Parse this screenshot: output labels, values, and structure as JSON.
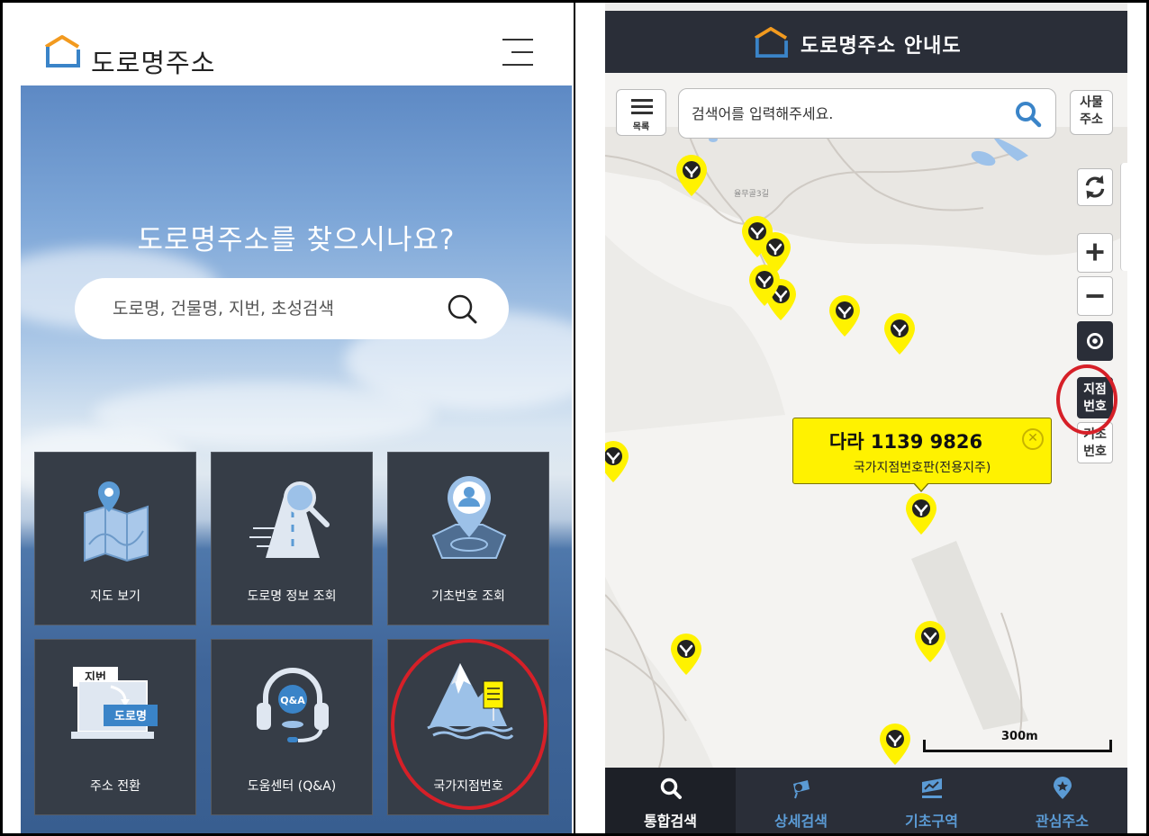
{
  "left_panel": {
    "header": {
      "title": "도로명주소"
    },
    "hero": {
      "heading": "도로명주소를 찾으시나요?",
      "search_placeholder": "도로명, 건물명, 지번, 초성검색"
    },
    "tiles": [
      {
        "label": "지도 보기",
        "icon": "map-pin-icon"
      },
      {
        "label": "도로명 정보 조회",
        "icon": "road-search-icon"
      },
      {
        "label": "기초번호 조회",
        "icon": "location-person-icon"
      },
      {
        "label": "주소 전환",
        "icon": "address-convert-icon",
        "badge_top": "지번",
        "badge_bottom": "도로명"
      },
      {
        "label": "도움센터 (Q&A)",
        "icon": "headset-icon",
        "badge": "Q&A"
      },
      {
        "label": "국가지점번호",
        "icon": "mountain-sign-icon",
        "highlighted": true
      }
    ]
  },
  "right_panel": {
    "header": {
      "title": "도로명주소 안내도"
    },
    "menu_button_label": "목록",
    "search_placeholder": "검색어를 입력해주세요.",
    "thing_address_button": {
      "line1": "사물",
      "line2": "주소"
    },
    "controls": {
      "point_number": {
        "line1": "지점",
        "line2": "번호",
        "highlighted": true
      },
      "base_number": {
        "line1": "기초",
        "line2": "번호"
      }
    },
    "map": {
      "road_label": "율무골3길",
      "popup": {
        "title": "다라 1139 9826",
        "subtitle": "국가지점번호판(전용지주)"
      },
      "scale_label": "300m",
      "marker_color": "#fff200"
    },
    "tabs": [
      {
        "label": "통합검색",
        "icon": "search-icon",
        "active": true,
        "color": "#ffffff"
      },
      {
        "label": "상세검색",
        "icon": "detail-search-icon",
        "active": false,
        "color": "#5b9bd5"
      },
      {
        "label": "기초구역",
        "icon": "zone-map-icon",
        "active": false,
        "color": "#5b9bd5"
      },
      {
        "label": "관심주소",
        "icon": "favorite-pin-icon",
        "active": false,
        "color": "#5b9bd5"
      }
    ]
  }
}
